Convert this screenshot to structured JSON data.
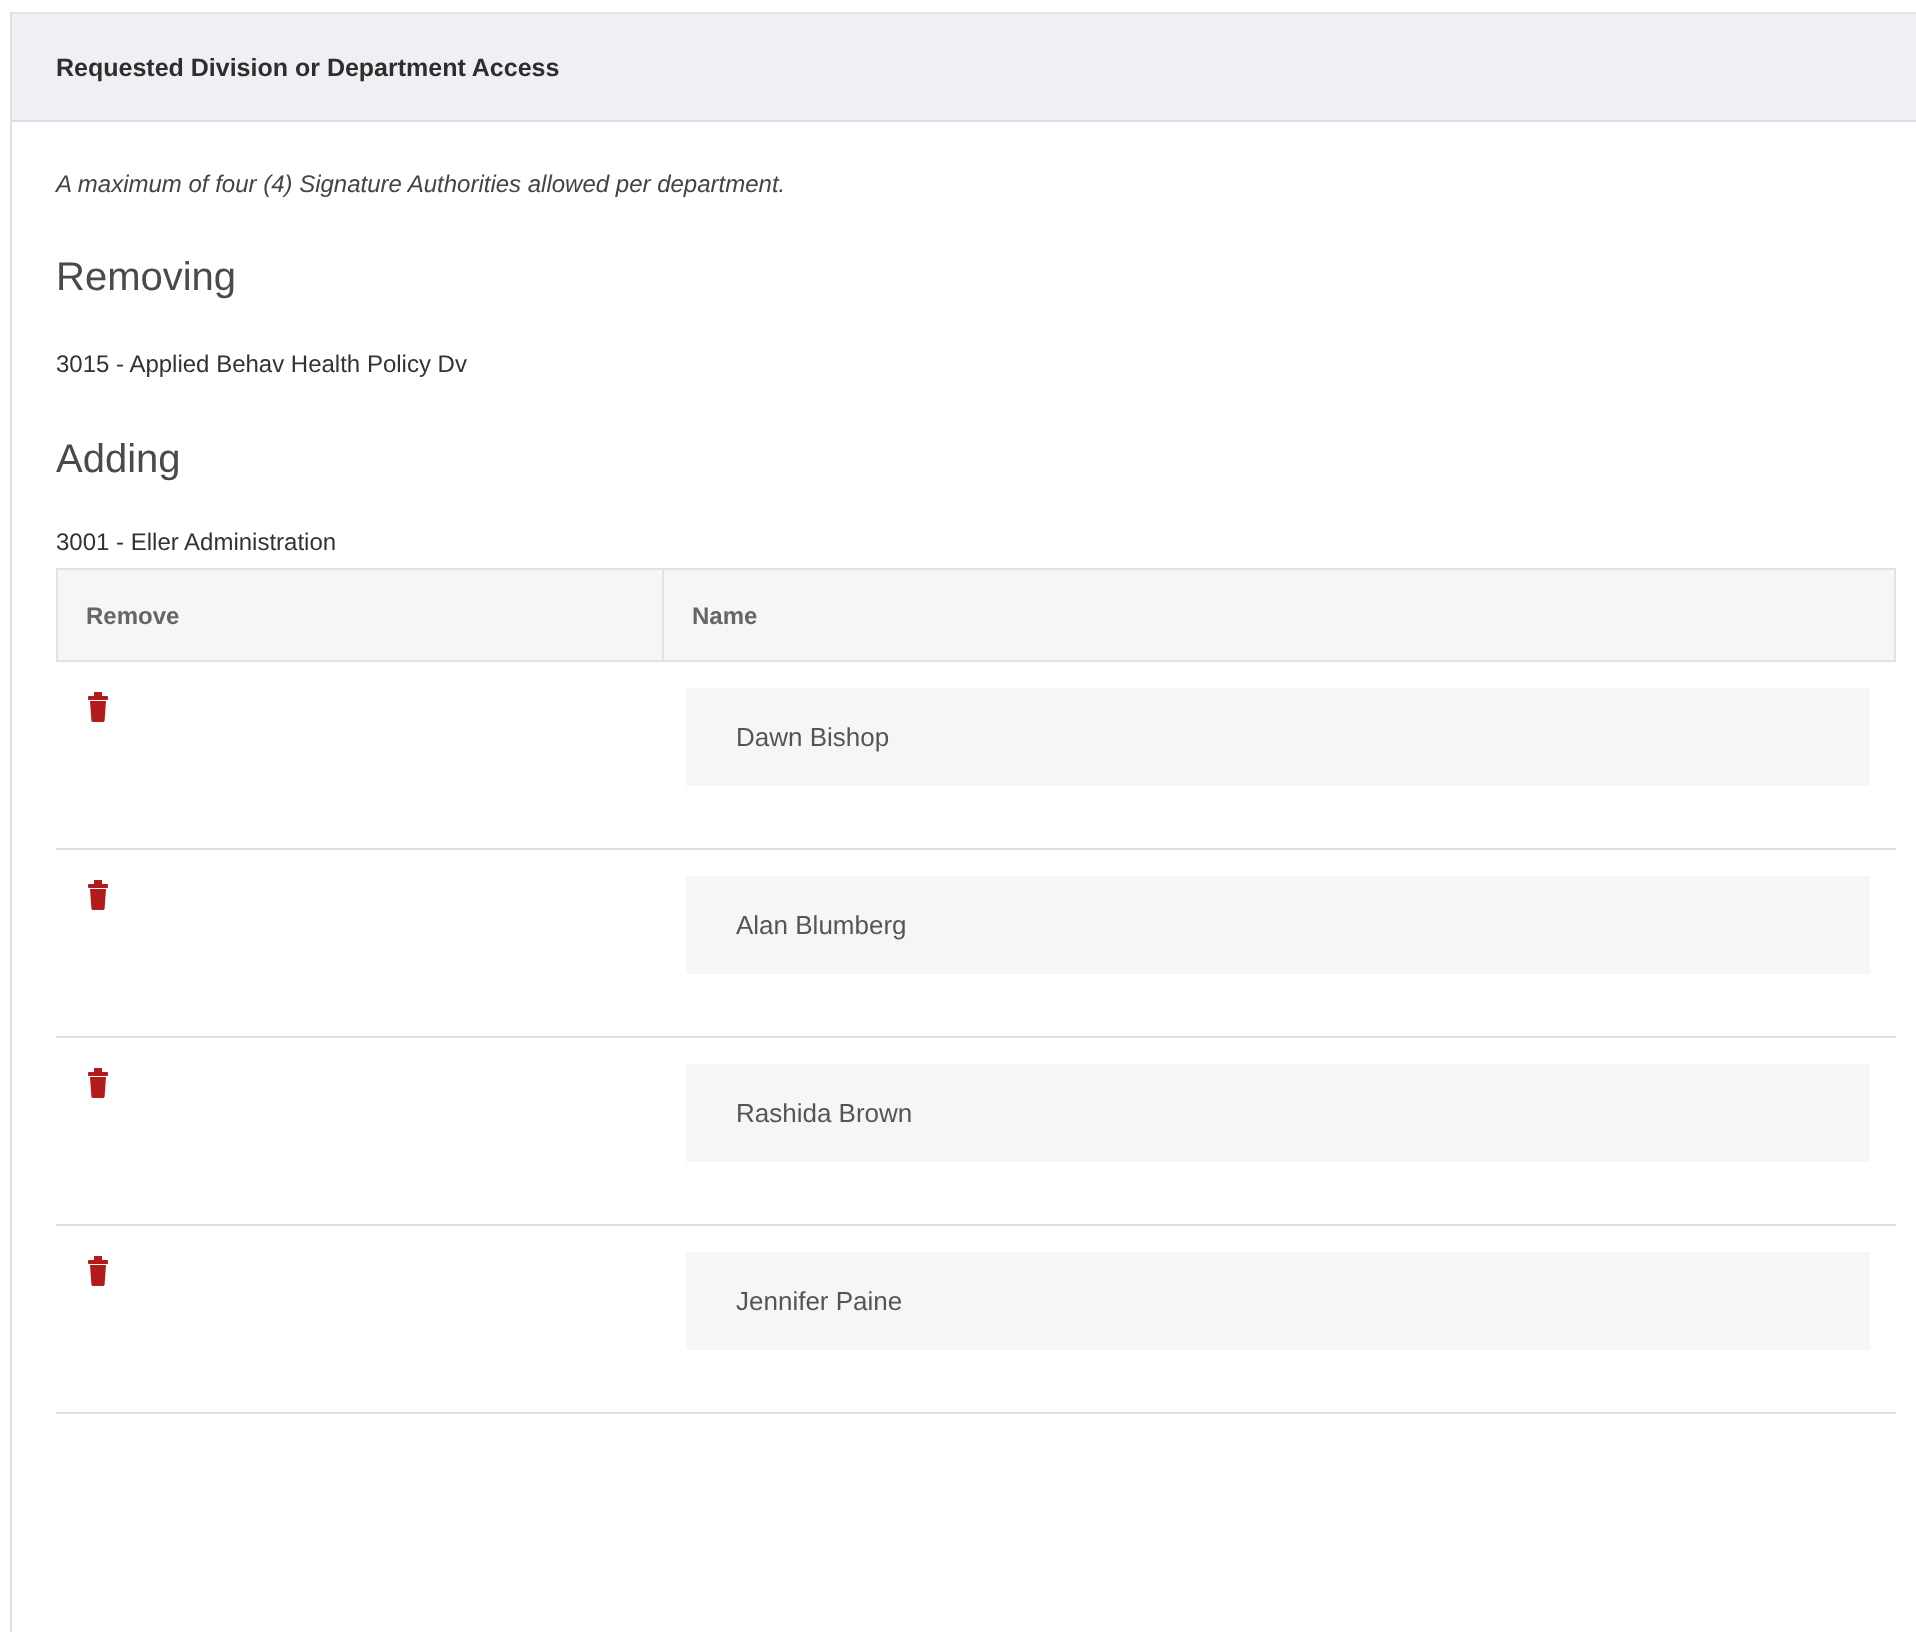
{
  "panel": {
    "title": "Requested Division or Department Access"
  },
  "note": "A maximum of four (4) Signature Authorities allowed per department.",
  "sections": [
    {
      "heading": "Removing",
      "department": "3015 - Applied Behav Health Policy Dv"
    },
    {
      "heading": "Adding",
      "department": "3001 - Eller Administration"
    }
  ],
  "table": {
    "columns": [
      "Remove",
      "Name"
    ],
    "rows": [
      {
        "name": "Dawn Bishop"
      },
      {
        "name": "Alan Blumberg"
      },
      {
        "name": "Rashida Brown"
      },
      {
        "name": "Jennifer Paine"
      }
    ]
  }
}
